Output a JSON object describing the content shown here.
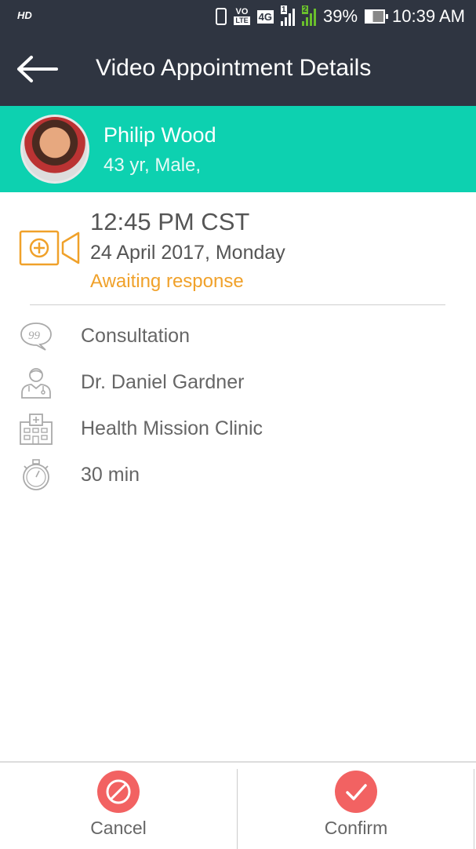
{
  "status_bar": {
    "hd_label": "HD",
    "volte_top": "VO",
    "volte_bottom": "LTE",
    "network": "4G",
    "sim1": "1",
    "sim2": "2",
    "battery_percent": "39%",
    "battery_level": 0.39,
    "time": "10:39 AM"
  },
  "app_bar": {
    "title": "Video Appointment Details",
    "back_icon": "arrow-left-icon"
  },
  "patient": {
    "name": "Philip Wood",
    "details": "43 yr, Male,"
  },
  "appointment": {
    "time": "12:45 PM CST",
    "date": "24 April 2017, Monday",
    "status": "Awaiting response",
    "status_color": "#f0a12a",
    "icon": "video-camera-plus-icon"
  },
  "info_rows": [
    {
      "icon": "speech-bubble-quote-icon",
      "label": "Consultation"
    },
    {
      "icon": "doctor-icon",
      "label": "Dr. Daniel Gardner"
    },
    {
      "icon": "hospital-icon",
      "label": "Health Mission Clinic"
    },
    {
      "icon": "stopwatch-icon",
      "label": "30 min"
    }
  ],
  "footer": {
    "cancel_label": "Cancel",
    "confirm_label": "Confirm",
    "accent_color": "#f26262"
  },
  "colors": {
    "header": "#2f3541",
    "patient_banner": "#0dd1b0"
  }
}
